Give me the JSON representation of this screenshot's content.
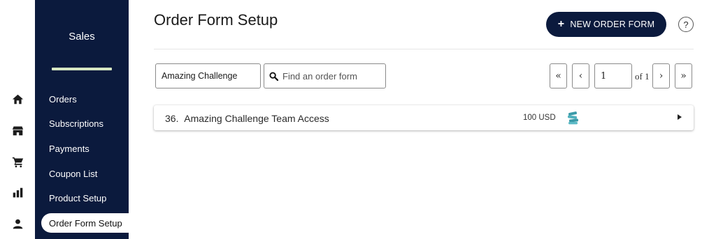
{
  "rail": {
    "icons": [
      "home-icon",
      "store-icon",
      "cart-icon",
      "bar-chart-icon",
      "user-icon"
    ]
  },
  "sidebar": {
    "title": "Sales",
    "items": [
      {
        "label": "Orders",
        "active": false
      },
      {
        "label": "Subscriptions",
        "active": false
      },
      {
        "label": "Payments",
        "active": false
      },
      {
        "label": "Coupon List",
        "active": false
      },
      {
        "label": "Product Setup",
        "active": false
      },
      {
        "label": "Order Form Setup",
        "active": true
      }
    ]
  },
  "header": {
    "title": "Order Form Setup",
    "new_button_label": "NEW ORDER FORM",
    "help_label": "?"
  },
  "filters": {
    "product_value": "Amazing Challenge",
    "search_placeholder": "Find an order form",
    "search_value": ""
  },
  "pagination": {
    "first_label": "«",
    "prev_label": "‹",
    "current_page": "1",
    "of_label": "of 1",
    "next_label": "›",
    "last_label": "»"
  },
  "orders": [
    {
      "number": "36.",
      "name": "Amazing Challenge Team Access",
      "price": "100 USD",
      "icon": "coins-icon"
    }
  ],
  "colors": {
    "sidebar_bg": "#0b1a3d",
    "accent_divider": "#d6e6c2",
    "coins": "#3a9aa8"
  }
}
